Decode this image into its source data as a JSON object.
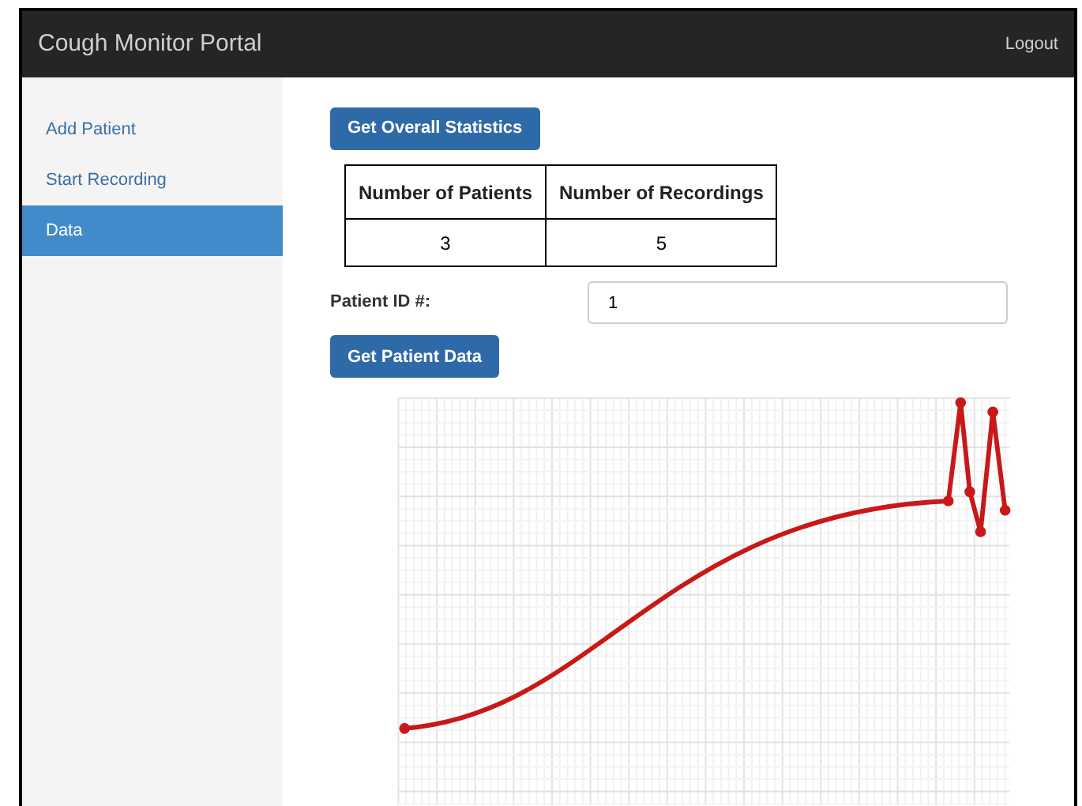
{
  "navbar": {
    "title": "Cough Monitor Portal",
    "logout": "Logout"
  },
  "sidebar": {
    "items": [
      {
        "label": "Add Patient",
        "selected": false
      },
      {
        "label": "Start Recording",
        "selected": false
      },
      {
        "label": "Data",
        "selected": true
      }
    ]
  },
  "stats_button": "Get Overall Statistics",
  "stats_table": {
    "columns": [
      "Number of Patients",
      "Number of Recordings"
    ],
    "rows": [
      [
        "3",
        "5"
      ]
    ]
  },
  "patient_id": {
    "label": "Patient ID #:",
    "value": "1"
  },
  "patient_button": "Get Patient Data"
}
